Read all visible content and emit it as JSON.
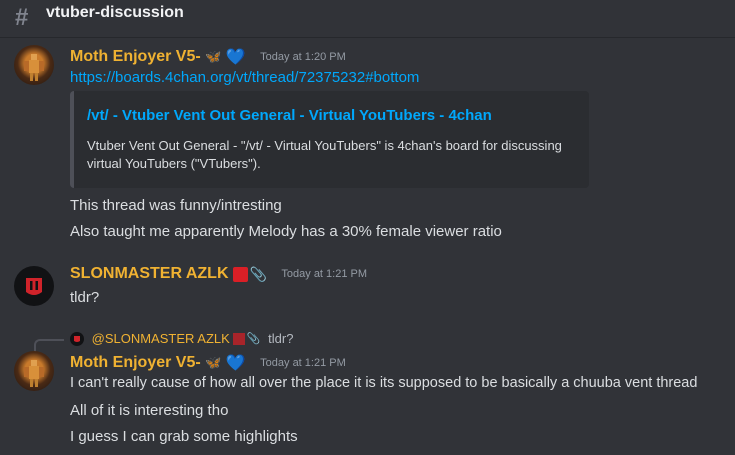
{
  "channel": {
    "name": "vtuber-discussion",
    "icon": "hash-icon"
  },
  "messages": [
    {
      "username": "Moth Enjoyer V5-",
      "emojis": [
        "🦋",
        "💙"
      ],
      "timestamp": "Today at 1:20 PM",
      "link": "https://boards.4chan.org/vt/thread/72375232#bottom",
      "embed": {
        "title": "/vt/ - Vtuber Vent Out General - Virtual YouTubers - 4chan",
        "description": "Vtuber Vent Out General - \"/vt/ - Virtual YouTubers\" is 4chan's board for discussing virtual YouTubers (\"VTubers\")."
      },
      "lines": [
        "This thread was funny/intresting",
        "Also taught me apparently Melody has a 30% female viewer ratio"
      ]
    },
    {
      "username": "SLONMASTER AZLK",
      "emojis": [
        "🟥",
        "📎"
      ],
      "timestamp": "Today at 1:21 PM",
      "lines": [
        "tldr?"
      ]
    },
    {
      "reply": {
        "username": "@SLONMASTER AZLK",
        "text": "tldr?"
      },
      "username": "Moth Enjoyer V5-",
      "emojis": [
        "🦋",
        "💙"
      ],
      "timestamp": "Today at 1:21 PM",
      "lines": [
        "I can't really cause of how all over the place it is its supposed to be basically a chuuba vent thread",
        "All of it is interesting tho",
        "I guess I can grab some highlights"
      ]
    }
  ],
  "colors": {
    "background": "#313338",
    "username": "#f0b232",
    "link": "#00a8fc",
    "text": "#dbdee1",
    "timestamp": "#949ba4"
  }
}
